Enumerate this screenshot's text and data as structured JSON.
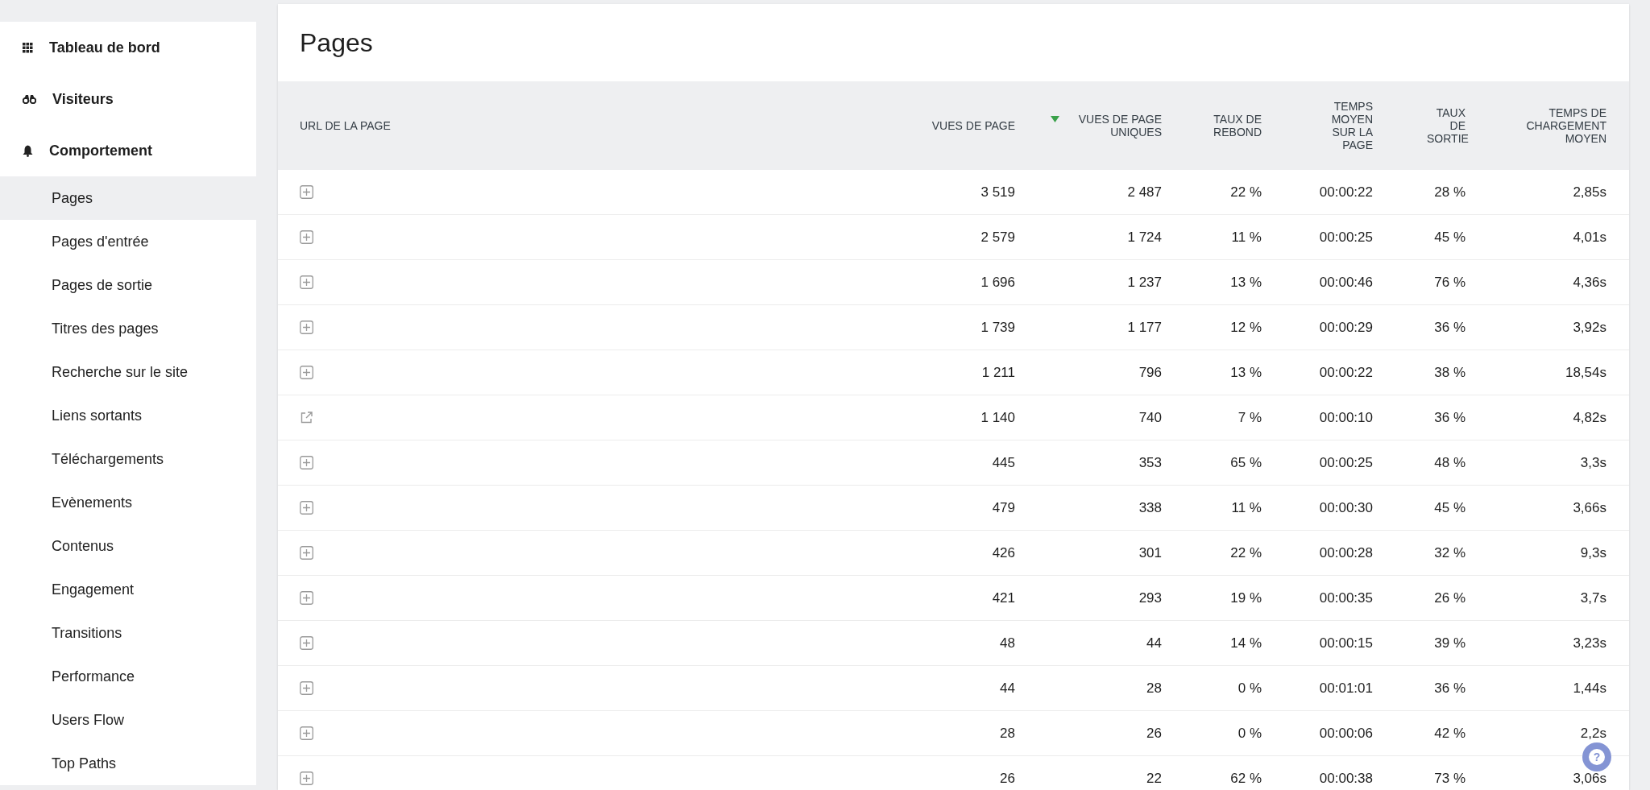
{
  "sidebar": {
    "sections": [
      {
        "label": "Tableau de bord",
        "kind": "grid"
      },
      {
        "label": "Visiteurs",
        "kind": "binoculars"
      },
      {
        "label": "Comportement",
        "kind": "bell"
      }
    ],
    "items": [
      {
        "label": "Pages",
        "selected": true
      },
      {
        "label": "Pages d'entrée",
        "selected": false
      },
      {
        "label": "Pages de sortie",
        "selected": false
      },
      {
        "label": "Titres des pages",
        "selected": false
      },
      {
        "label": "Recherche sur le site",
        "selected": false
      },
      {
        "label": "Liens sortants",
        "selected": false
      },
      {
        "label": "Téléchargements",
        "selected": false
      },
      {
        "label": "Evènements",
        "selected": false
      },
      {
        "label": "Contenus",
        "selected": false
      },
      {
        "label": "Engagement",
        "selected": false
      },
      {
        "label": "Transitions",
        "selected": false
      },
      {
        "label": "Performance",
        "selected": false
      },
      {
        "label": "Users Flow",
        "selected": false
      },
      {
        "label": "Top Paths",
        "selected": false
      }
    ]
  },
  "page": {
    "title": "Pages"
  },
  "table": {
    "columns": [
      {
        "label": "URL DE LA PAGE",
        "sorted": false
      },
      {
        "label": "VUES DE PAGE",
        "sorted": false
      },
      {
        "label": "VUES DE PAGE UNIQUES",
        "sorted": true
      },
      {
        "label": "TAUX DE REBOND",
        "sorted": false
      },
      {
        "label": "TEMPS MOYEN SUR LA PAGE",
        "sorted": false
      },
      {
        "label": "TAUX DE SORTIE",
        "sorted": false
      },
      {
        "label": "TEMPS DE CHARGEMENT MOYEN",
        "sorted": false
      }
    ],
    "rows": [
      {
        "kind": "expand",
        "cells": [
          "",
          "3 519",
          "2 487",
          "22 %",
          "00:00:22",
          "28 %",
          "2,85s"
        ]
      },
      {
        "kind": "expand",
        "cells": [
          "",
          "2 579",
          "1 724",
          "11 %",
          "00:00:25",
          "45 %",
          "4,01s"
        ]
      },
      {
        "kind": "expand",
        "cells": [
          "",
          "1 696",
          "1 237",
          "13 %",
          "00:00:46",
          "76 %",
          "4,36s"
        ]
      },
      {
        "kind": "expand",
        "cells": [
          "",
          "1 739",
          "1 177",
          "12 %",
          "00:00:29",
          "36 %",
          "3,92s"
        ]
      },
      {
        "kind": "expand",
        "cells": [
          "",
          "1 211",
          "796",
          "13 %",
          "00:00:22",
          "38 %",
          "18,54s"
        ]
      },
      {
        "kind": "external",
        "cells": [
          "",
          "1 140",
          "740",
          "7 %",
          "00:00:10",
          "36 %",
          "4,82s"
        ]
      },
      {
        "kind": "expand",
        "cells": [
          "",
          "445",
          "353",
          "65 %",
          "00:00:25",
          "48 %",
          "3,3s"
        ]
      },
      {
        "kind": "expand",
        "cells": [
          "",
          "479",
          "338",
          "11 %",
          "00:00:30",
          "45 %",
          "3,66s"
        ]
      },
      {
        "kind": "expand",
        "cells": [
          "",
          "426",
          "301",
          "22 %",
          "00:00:28",
          "32 %",
          "9,3s"
        ]
      },
      {
        "kind": "expand",
        "cells": [
          "",
          "421",
          "293",
          "19 %",
          "00:00:35",
          "26 %",
          "3,7s"
        ]
      },
      {
        "kind": "expand",
        "cells": [
          "",
          "48",
          "44",
          "14 %",
          "00:00:15",
          "39 %",
          "3,23s"
        ]
      },
      {
        "kind": "expand",
        "cells": [
          "",
          "44",
          "28",
          "0 %",
          "00:01:01",
          "36 %",
          "1,44s"
        ]
      },
      {
        "kind": "expand",
        "cells": [
          "",
          "28",
          "26",
          "0 %",
          "00:00:06",
          "42 %",
          "2,2s"
        ]
      },
      {
        "kind": "expand",
        "cells": [
          "",
          "26",
          "22",
          "62 %",
          "00:00:38",
          "73 %",
          "3,06s"
        ]
      }
    ]
  },
  "help_button": {
    "label": "?"
  }
}
